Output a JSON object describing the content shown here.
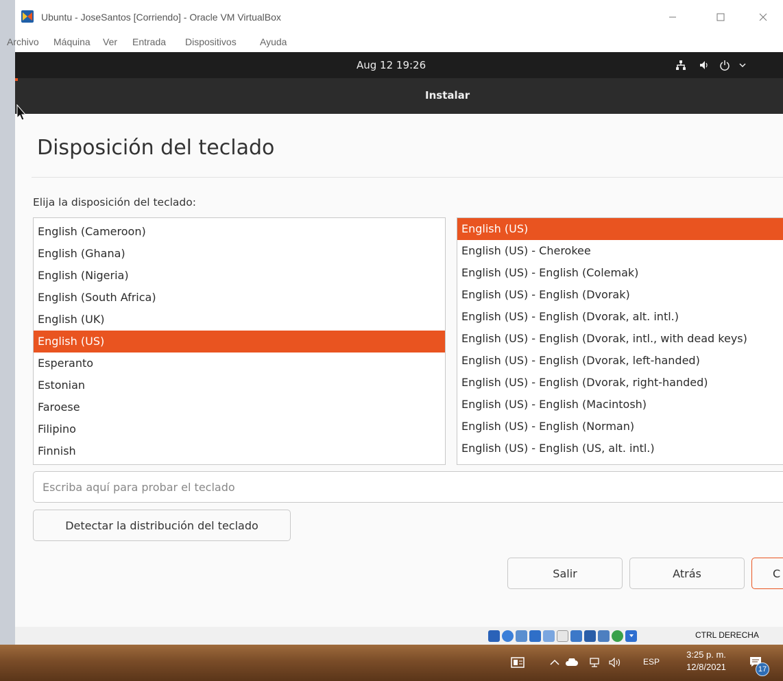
{
  "window": {
    "title": "Ubuntu - JoseSantos [Corriendo] - Oracle VM VirtualBox",
    "menu": [
      "Archivo",
      "Máquina",
      "Ver",
      "Entrada",
      "Dispositivos",
      "Ayuda"
    ]
  },
  "guest_topbar": {
    "clock": "Aug 12  19:26"
  },
  "installer": {
    "header_title": "Instalar",
    "page_title": "Disposición del teclado",
    "prompt": "Elija la disposición del teclado:",
    "layouts": [
      "English (Cameroon)",
      "English (Ghana)",
      "English (Nigeria)",
      "English (South Africa)",
      "English (UK)",
      "English (US)",
      "Esperanto",
      "Estonian",
      "Faroese",
      "Filipino",
      "Finnish"
    ],
    "selected_layout": "English (US)",
    "variants": [
      "English (US)",
      "English (US) - Cherokee",
      "English (US) - English (Colemak)",
      "English (US) - English (Dvorak)",
      "English (US) - English (Dvorak, alt. intl.)",
      "English (US) - English (Dvorak, intl., with dead keys)",
      "English (US) - English (Dvorak, left-handed)",
      "English (US) - English (Dvorak, right-handed)",
      "English (US) - English (Macintosh)",
      "English (US) - English (Norman)",
      "English (US) - English (US, alt. intl.)"
    ],
    "selected_variant": "English (US)",
    "test_input": {
      "placeholder": "Escriba aquí para probar el teclado",
      "value": ""
    },
    "detect_button": "Detectar la distribución del teclado",
    "buttons": {
      "exit": "Salir",
      "back": "Atrás",
      "next": "C"
    }
  },
  "vbox_status": {
    "host_key": "CTRL DERECHA"
  },
  "taskbar": {
    "language": "ESP",
    "time": "3:25 p. m.",
    "date": "12/8/2021",
    "notifications": "17"
  },
  "colors": {
    "accent": "#e95420",
    "topbar": "#1d1d1d",
    "header": "#2c2c2c"
  }
}
